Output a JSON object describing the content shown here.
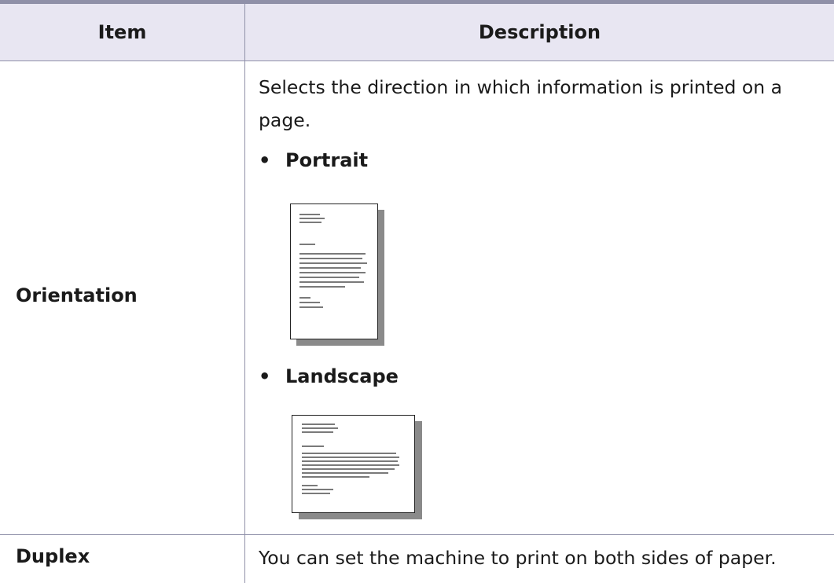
{
  "header": {
    "item": "Item",
    "description": "Description"
  },
  "rows": [
    {
      "item": "Orientation",
      "description": "Selects the direction in which information is printed on a page.",
      "options": [
        {
          "label": "Portrait",
          "icon": "portrait-page-icon"
        },
        {
          "label": "Landscape",
          "icon": "landscape-page-icon"
        }
      ]
    },
    {
      "item": "Duplex",
      "description": "You can set the machine to print on both sides of paper."
    }
  ],
  "colors": {
    "rule": "#8f90a8",
    "header_bg": "#e8e6f2"
  }
}
